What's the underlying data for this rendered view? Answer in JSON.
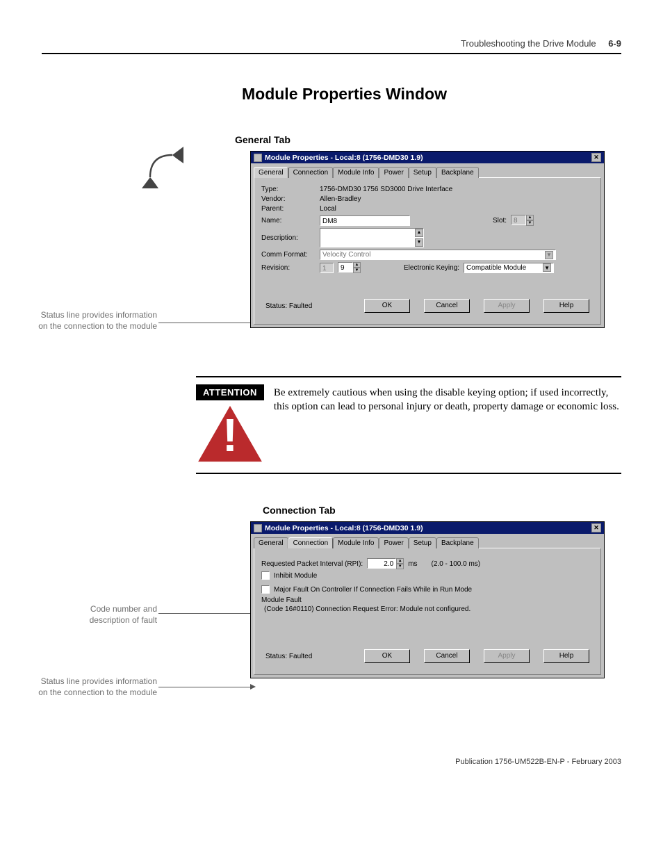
{
  "header": {
    "text": "Troubleshooting the Drive Module",
    "page": "6-9"
  },
  "section_title": "Module Properties Window",
  "general": {
    "heading": "General Tab",
    "dialog_title": "Module Properties - Local:8 (1756-DMD30 1.9)",
    "tabs": [
      "General",
      "Connection",
      "Module Info",
      "Power",
      "Setup",
      "Backplane"
    ],
    "type_label": "Type:",
    "type_value": "1756-DMD30 1756 SD3000 Drive Interface",
    "vendor_label": "Vendor:",
    "vendor_value": "Allen-Bradley",
    "parent_label": "Parent:",
    "parent_value": "Local",
    "name_label": "Name:",
    "name_value": "DM8",
    "slot_label": "Slot:",
    "slot_value": "8",
    "desc_label": "Description:",
    "comm_label": "Comm Format:",
    "comm_value": "Velocity Control",
    "rev_label": "Revision:",
    "rev_major": "1",
    "rev_minor": "9",
    "ekey_label": "Electronic Keying:",
    "ekey_value": "Compatible Module",
    "status_label": "Status: Faulted",
    "ok": "OK",
    "cancel": "Cancel",
    "apply": "Apply",
    "help": "Help",
    "annotation": "Status line provides information on the connection to the module"
  },
  "attention": {
    "label": "ATTENTION",
    "text": "Be extremely cautious when using the disable keying option; if used incorrectly, this option can lead to personal injury or death, property damage or economic loss."
  },
  "connection": {
    "heading": "Connection Tab",
    "dialog_title": "Module Properties - Local:8 (1756-DMD30 1.9)",
    "tabs": [
      "General",
      "Connection",
      "Module Info",
      "Power",
      "Setup",
      "Backplane"
    ],
    "rpi_label": "Requested Packet Interval (RPI):",
    "rpi_value": "2.0",
    "rpi_units": "ms",
    "rpi_range": "(2.0 - 100.0 ms)",
    "inhibit_label": "Inhibit Module",
    "major_label": "Major Fault On Controller If Connection Fails While in Run Mode",
    "mf_heading": "Module Fault",
    "mf_text": "(Code 16#0110) Connection Request Error: Module not configured.",
    "status_label": "Status: Faulted",
    "ok": "OK",
    "cancel": "Cancel",
    "apply": "Apply",
    "help": "Help",
    "annotation_fault": "Code number and description of fault",
    "annotation_status": "Status line provides information on the connection to the module"
  },
  "publication": "Publication 1756-UM522B-EN-P - February 2003"
}
